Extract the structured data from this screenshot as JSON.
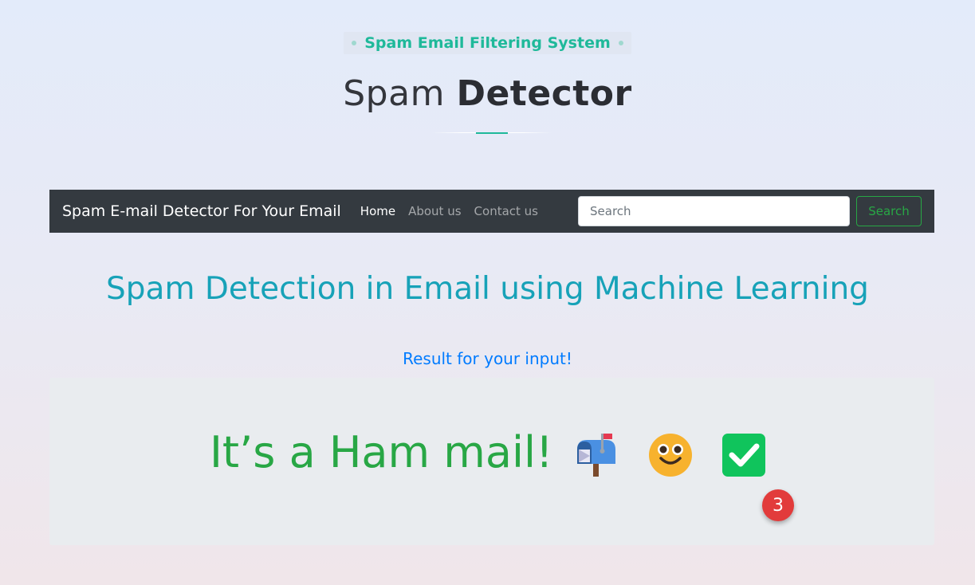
{
  "header": {
    "eyebrow": "Spam Email Filtering System",
    "title_light": "Spam",
    "title_bold": "Detector"
  },
  "navbar": {
    "brand": "Spam E-mail Detector For Your Email",
    "links": [
      "Home",
      "About us",
      "Contact us"
    ],
    "active_link": "Home",
    "search_placeholder": "Search",
    "search_button": "Search"
  },
  "main": {
    "heading": "Spam Detection in Email using Machine Learning",
    "result_label": "Result for your input!",
    "result_text": "It’s a Ham mail!",
    "icons": [
      "mailbox-icon",
      "smiling-face-icon",
      "check-mark-icon"
    ],
    "badge_count": "3"
  },
  "colors": {
    "accent_teal": "#1fb99a",
    "navbar_bg": "#343a40",
    "heading_cyan": "#17a2b8",
    "link_blue": "#007bff",
    "success_green": "#28a745",
    "panel_bg": "#e9ecef",
    "badge_red": "#e23b3b"
  }
}
